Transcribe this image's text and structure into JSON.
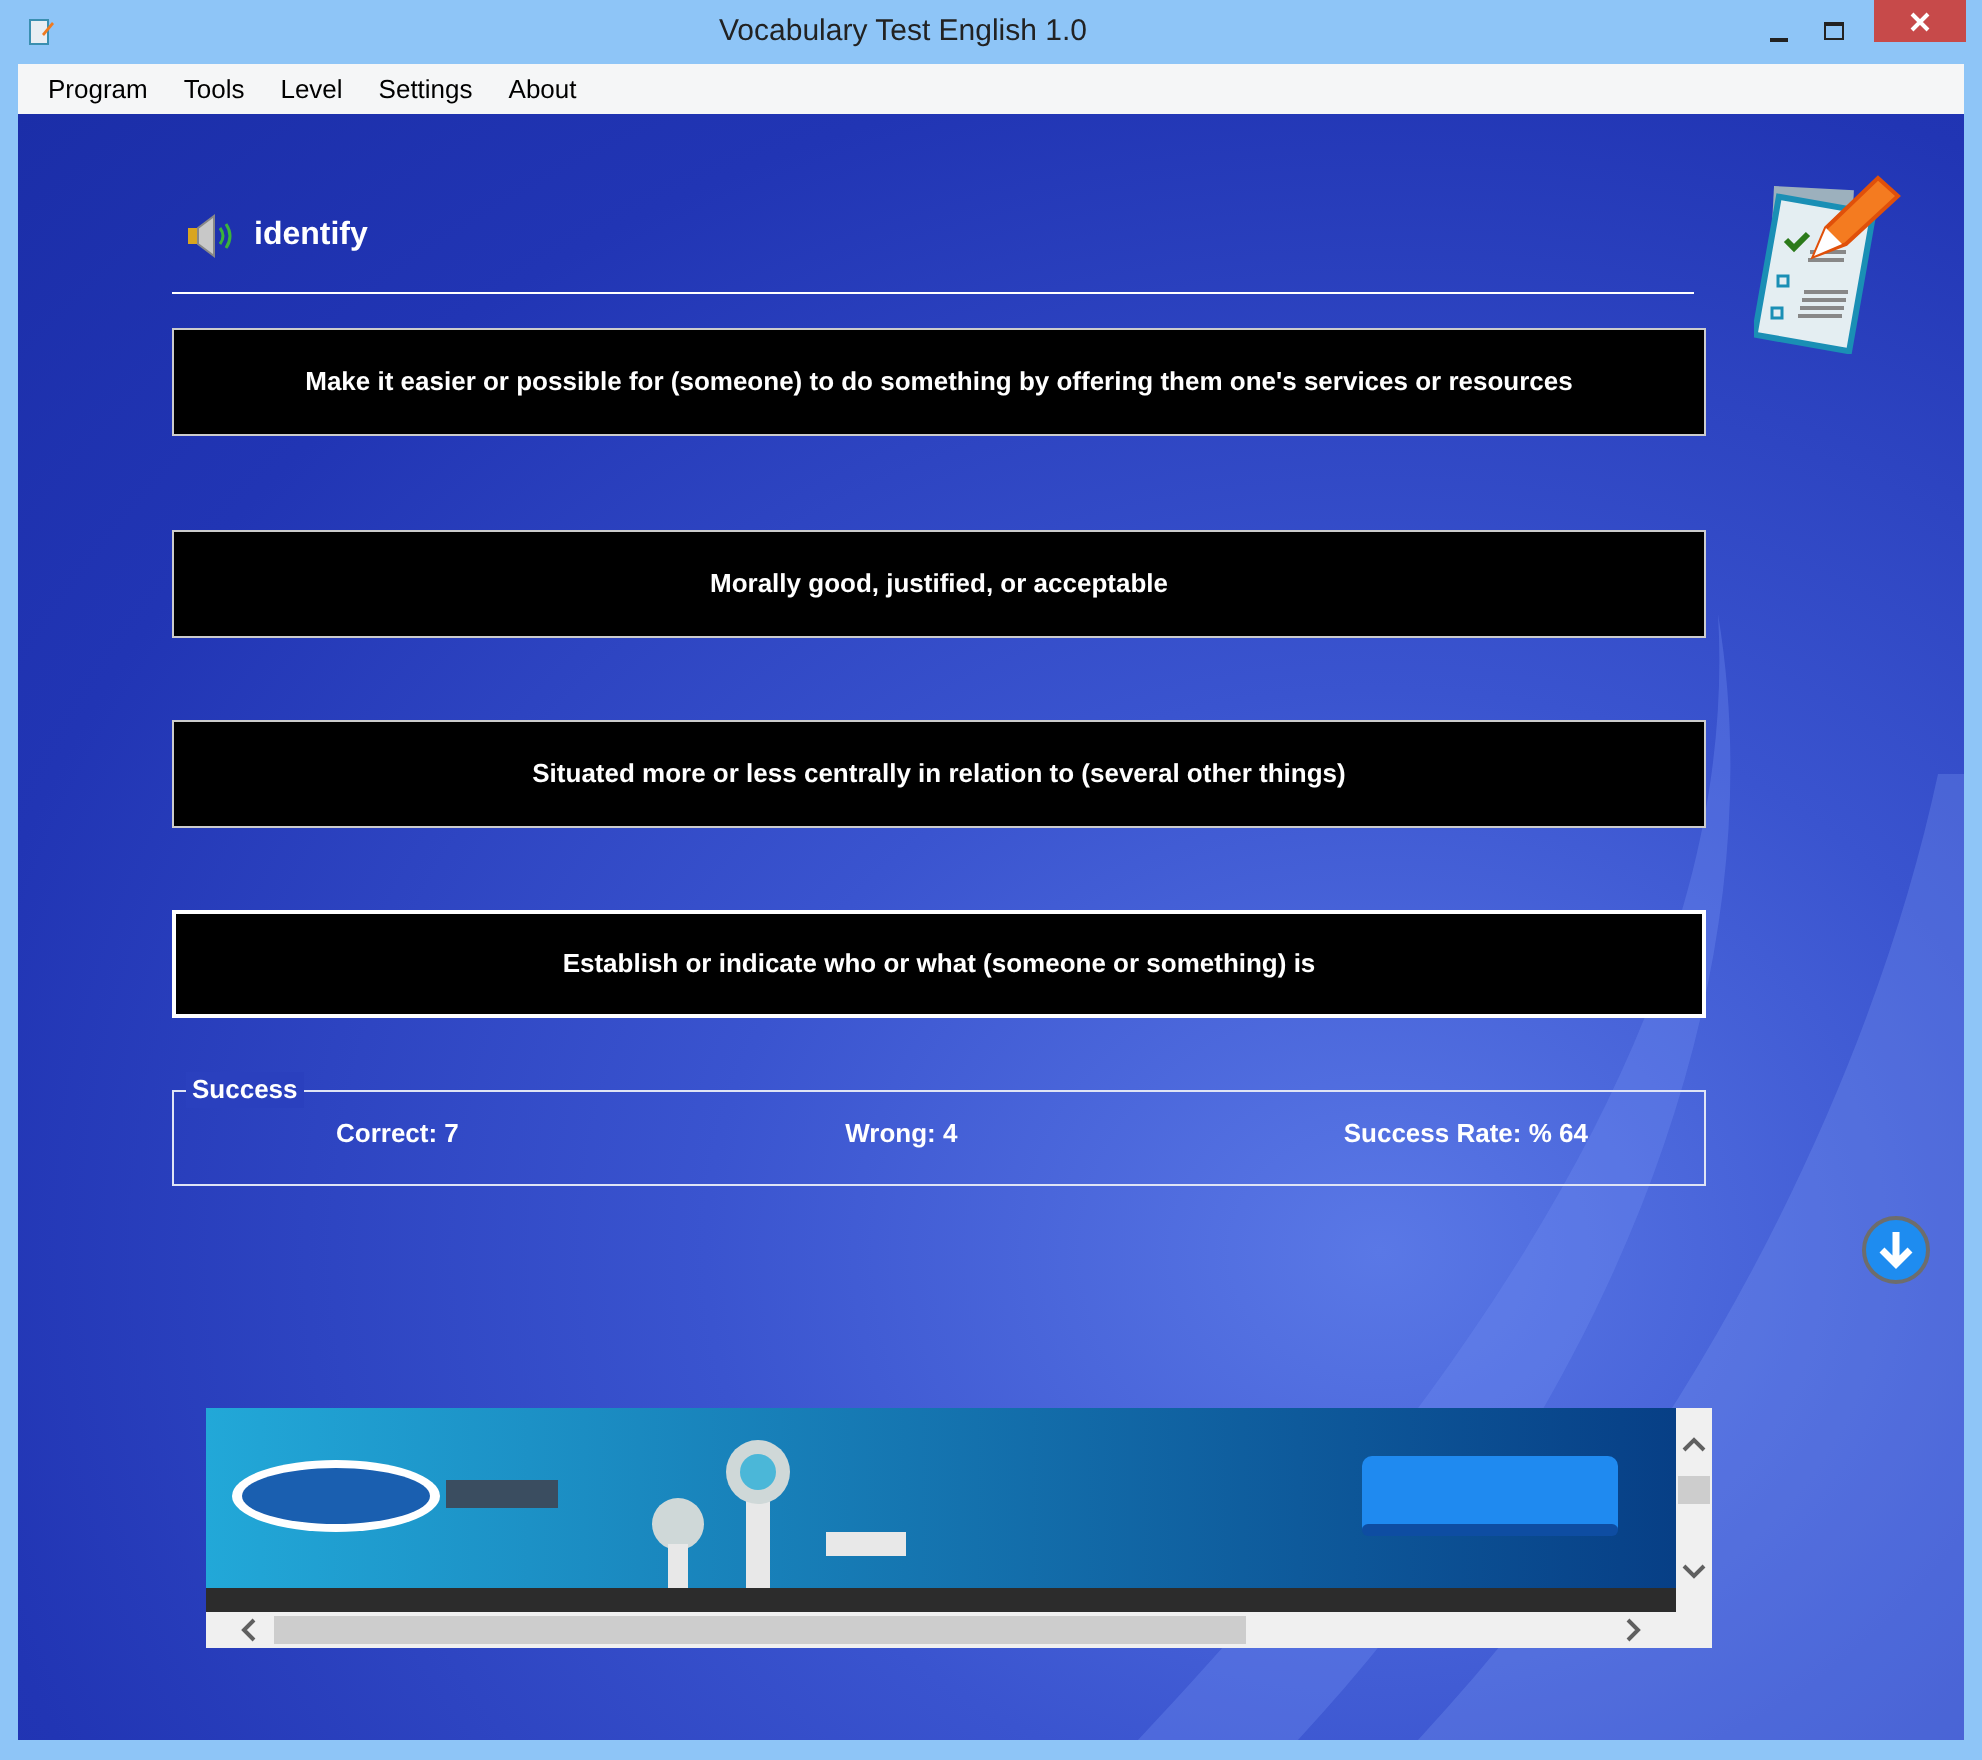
{
  "window": {
    "title": "Vocabulary Test English 1.0"
  },
  "menu": [
    "Program",
    "Tools",
    "Level",
    "Settings",
    "About"
  ],
  "word": "identify",
  "options": [
    {
      "text": "Make it easier or possible for (someone) to do something by offering them one's services or resources",
      "selected": false
    },
    {
      "text": "Morally good, justified, or acceptable",
      "selected": false
    },
    {
      "text": "Situated more or less centrally in relation to (several other things)",
      "selected": false
    },
    {
      "text": "Establish or indicate who or what (someone or something) is",
      "selected": true
    }
  ],
  "success": {
    "legend": "Success",
    "correct": "Correct: 7",
    "wrong": "Wrong: 4",
    "rate": "Success Rate: % 64"
  }
}
